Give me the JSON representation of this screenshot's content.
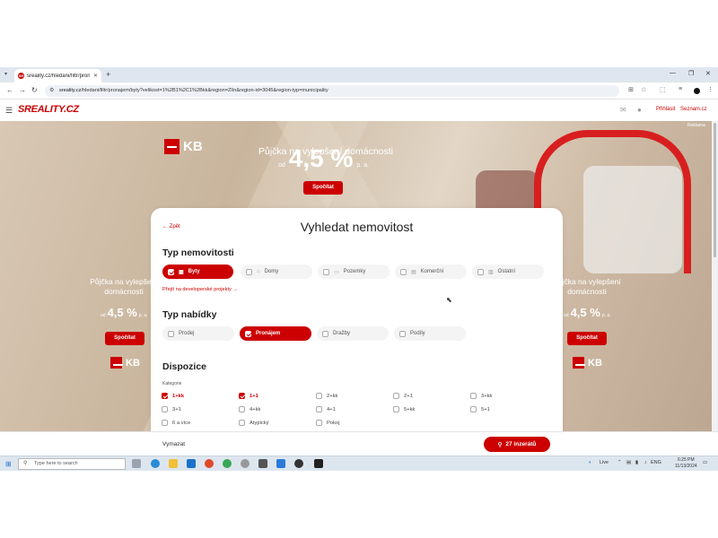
{
  "browser": {
    "tab_title": "sreality.cz/hledani/filtr/pronajem",
    "tab_favicon": "SR",
    "url_host": "sreality.cz",
    "url_path": "/hledani/filtr/pronajem/byty?velikost=1%2B1%2C1%2Bkk&region=Zlín&region-id=3045&region-typ=municipality"
  },
  "site": {
    "logo": "SREALITY.CZ",
    "login": "Přihlásit",
    "seznam": "Seznam.cz"
  },
  "ad": {
    "label": "Reklama",
    "brand": "KB",
    "title": "Půjčka na vylepšení domácnosti",
    "rate_prefix": "od",
    "rate": "4,5 %",
    "rate_suffix": "p. a.",
    "cta": "Spočítat",
    "side_text": "Půjčka na vylepšení domácnosti"
  },
  "search": {
    "back": "Zpět",
    "title": "Vyhledat nemovitost",
    "property_type": {
      "heading": "Typ nemovitosti",
      "options": [
        {
          "label": "Byty",
          "selected": true
        },
        {
          "label": "Domy",
          "selected": false
        },
        {
          "label": "Pozemky",
          "selected": false
        },
        {
          "label": "Komerční",
          "selected": false
        },
        {
          "label": "Ostatní",
          "selected": false
        }
      ],
      "dev_link": "Přejít na developerské projekty"
    },
    "offer_type": {
      "heading": "Typ nabídky",
      "options": [
        {
          "label": "Prodej",
          "selected": false
        },
        {
          "label": "Pronájem",
          "selected": true
        },
        {
          "label": "Dražby",
          "selected": false
        },
        {
          "label": "Podíly",
          "selected": false
        }
      ]
    },
    "disposition": {
      "heading": "Dispozice",
      "category_label": "Kategorie",
      "options": [
        {
          "label": "1+kk",
          "checked": true
        },
        {
          "label": "1+1",
          "checked": true
        },
        {
          "label": "2+kk",
          "checked": false
        },
        {
          "label": "2+1",
          "checked": false
        },
        {
          "label": "3+kk",
          "checked": false
        },
        {
          "label": "3+1",
          "checked": false
        },
        {
          "label": "4+kk",
          "checked": false
        },
        {
          "label": "4+1",
          "checked": false
        },
        {
          "label": "5+kk",
          "checked": false
        },
        {
          "label": "5+1",
          "checked": false
        },
        {
          "label": "6 a více",
          "checked": false
        },
        {
          "label": "Atypický",
          "checked": false
        },
        {
          "label": "Pokoj",
          "checked": false
        }
      ]
    },
    "reset": "Vymazat",
    "results_button": "27 inzerátů"
  },
  "taskbar": {
    "search_placeholder": "Type here to search",
    "weather": "Live",
    "lang": "ENG",
    "time": "6:25 PM",
    "date": "11/13/2024"
  },
  "colors": {
    "accent": "#cc0000"
  }
}
